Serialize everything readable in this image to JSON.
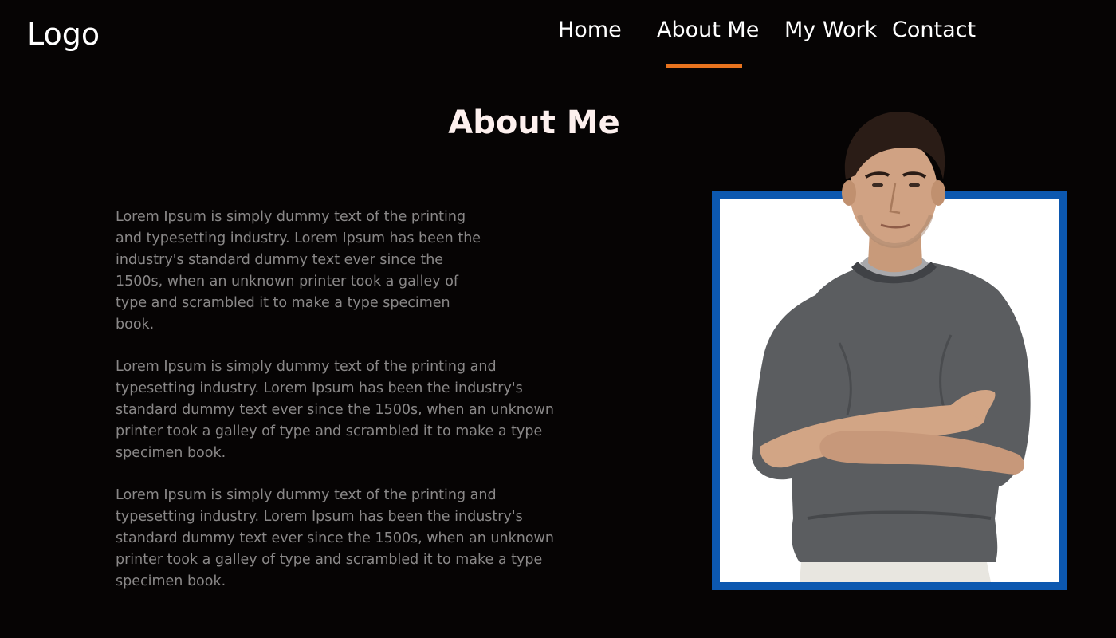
{
  "header": {
    "logo": "Logo",
    "nav": [
      {
        "label": "Home"
      },
      {
        "label": "About Me",
        "active": true
      },
      {
        "label": "My Work"
      },
      {
        "label": "Contact"
      }
    ],
    "active_color": "#e8731e"
  },
  "main": {
    "title": "About Me",
    "paragraphs": [
      "Lorem Ipsum is simply dummy text of the printing and typesetting industry. Lorem Ipsum has been the industry's standard dummy text ever since the 1500s, when an unknown printer took a galley of type and scrambled it to make a type specimen book.",
      "Lorem Ipsum is simply dummy text of the printing and typesetting industry. Lorem Ipsum has been the industry's standard dummy text ever since the 1500s, when an unknown printer took a galley of type and scrambled it to make a type specimen book.",
      "Lorem Ipsum is simply dummy text of the printing and typesetting industry. Lorem Ipsum has been the industry's standard dummy text ever since the 1500s, when an unknown printer took a galley of type and scrambled it to make a type specimen book."
    ],
    "photo_frame_color": "#0c58b0"
  }
}
